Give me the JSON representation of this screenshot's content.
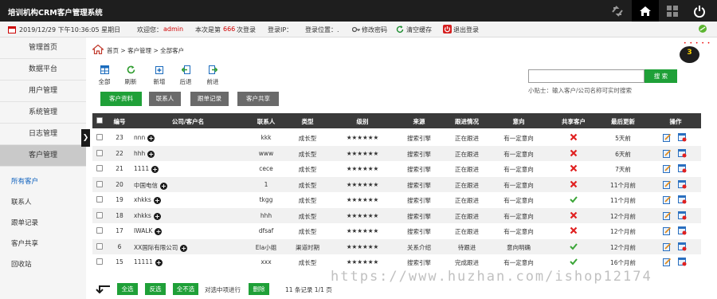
{
  "header": {
    "app_title": "培训机构CRM客户管理系统"
  },
  "info": {
    "datetime": "2019/12/29 下午10:36:05 星期日",
    "welcome": "欢迎您：",
    "user": "admin",
    "login_prefix": "本次是第",
    "login_count": "666",
    "login_suffix": "次登录",
    "ip_label": "登录IP：",
    "location_label": "登录位置：.",
    "change_pwd": "修改密码",
    "clear_cache": "清空缓存",
    "logout": "退出登录"
  },
  "sidebar": {
    "menu": [
      "管理首页",
      "数据平台",
      "用户管理",
      "系统管理",
      "日志管理",
      "客户管理"
    ],
    "sub": [
      "所有客户",
      "联系人",
      "跟单记录",
      "客户共享",
      "回收站"
    ]
  },
  "breadcrumb": {
    "home": "首页",
    "sep": " > ",
    "level1": "客户管理",
    "level2": "全部客户"
  },
  "toolbar": {
    "all": "全部",
    "refresh": "刷新",
    "add": "新增",
    "back": "后退",
    "forward": "前进"
  },
  "tabs": {
    "customer_info": "客户资料",
    "contacts": "联系人",
    "follow_record": "跟单记录",
    "customer_share": "客户共享"
  },
  "search": {
    "value": "",
    "button": "搜 索",
    "hint": "小贴士：输入客户/公司名称可实时搜索"
  },
  "badge": {
    "count": "3"
  },
  "table": {
    "headers": [
      "编号",
      "公司/客户名",
      "联系人",
      "类型",
      "级别",
      "来源",
      "跟进情况",
      "意向",
      "共享客户",
      "最后更新",
      "操作"
    ],
    "rows": [
      {
        "id": "23",
        "name": "nnn",
        "contact": "kkk",
        "type": "成长型",
        "level": "★★★★★★",
        "source": "搜索引擎",
        "status": "正在跟进",
        "intent": "有一定意向",
        "shared": false,
        "updated": "5天前"
      },
      {
        "id": "22",
        "name": "hhh",
        "contact": "www",
        "type": "成长型",
        "level": "★★★★★★",
        "source": "搜索引擎",
        "status": "正在跟进",
        "intent": "有一定意向",
        "shared": false,
        "updated": "6天前"
      },
      {
        "id": "21",
        "name": "1111",
        "contact": "cece",
        "type": "成长型",
        "level": "★★★★★★",
        "source": "搜索引擎",
        "status": "正在跟进",
        "intent": "有一定意向",
        "shared": false,
        "updated": "7天前"
      },
      {
        "id": "20",
        "name": "中国电信",
        "contact": "1",
        "type": "成长型",
        "level": "★★★★★★",
        "source": "搜索引擎",
        "status": "正在跟进",
        "intent": "有一定意向",
        "shared": false,
        "updated": "11个月前"
      },
      {
        "id": "19",
        "name": "xhkks",
        "contact": "tkgg",
        "type": "成长型",
        "level": "★★★★★★",
        "source": "搜索引擎",
        "status": "正在跟进",
        "intent": "有一定意向",
        "shared": true,
        "updated": "11个月前"
      },
      {
        "id": "18",
        "name": "xhkks",
        "contact": "hhh",
        "type": "成长型",
        "level": "★★★★★★",
        "source": "搜索引擎",
        "status": "正在跟进",
        "intent": "有一定意向",
        "shared": false,
        "updated": "12个月前"
      },
      {
        "id": "17",
        "name": "IWALK",
        "contact": "dfsaf",
        "type": "成长型",
        "level": "★★★★★★",
        "source": "搜索引擎",
        "status": "正在跟进",
        "intent": "有一定意向",
        "shared": false,
        "updated": "12个月前"
      },
      {
        "id": "6",
        "name": "XX国际有限公司",
        "contact": "Ela小姐",
        "type": "渠道时期",
        "level": "★★★★★★",
        "source": "关系介绍",
        "status": "待跟进",
        "intent": "意向明确",
        "shared": true,
        "updated": "12个月前"
      },
      {
        "id": "15",
        "name": "11111",
        "contact": "xxx",
        "type": "成长型",
        "level": "★★★★★★",
        "source": "搜索引擎",
        "status": "完成跟进",
        "intent": "有一定意向",
        "shared": true,
        "updated": "16个月前"
      }
    ]
  },
  "footer": {
    "select_all": "全选",
    "invert": "反选",
    "deselect": "全不选",
    "selected_action": "对选中项进行",
    "delete": "删除",
    "records": "11 条记录 1/1 页"
  },
  "watermark": "https://www.huzhan.com/ishop12174",
  "colors": {
    "green": "#1fa038",
    "dark": "#1e1e1e",
    "header": "#3a3a3a",
    "red": "#d00000"
  }
}
